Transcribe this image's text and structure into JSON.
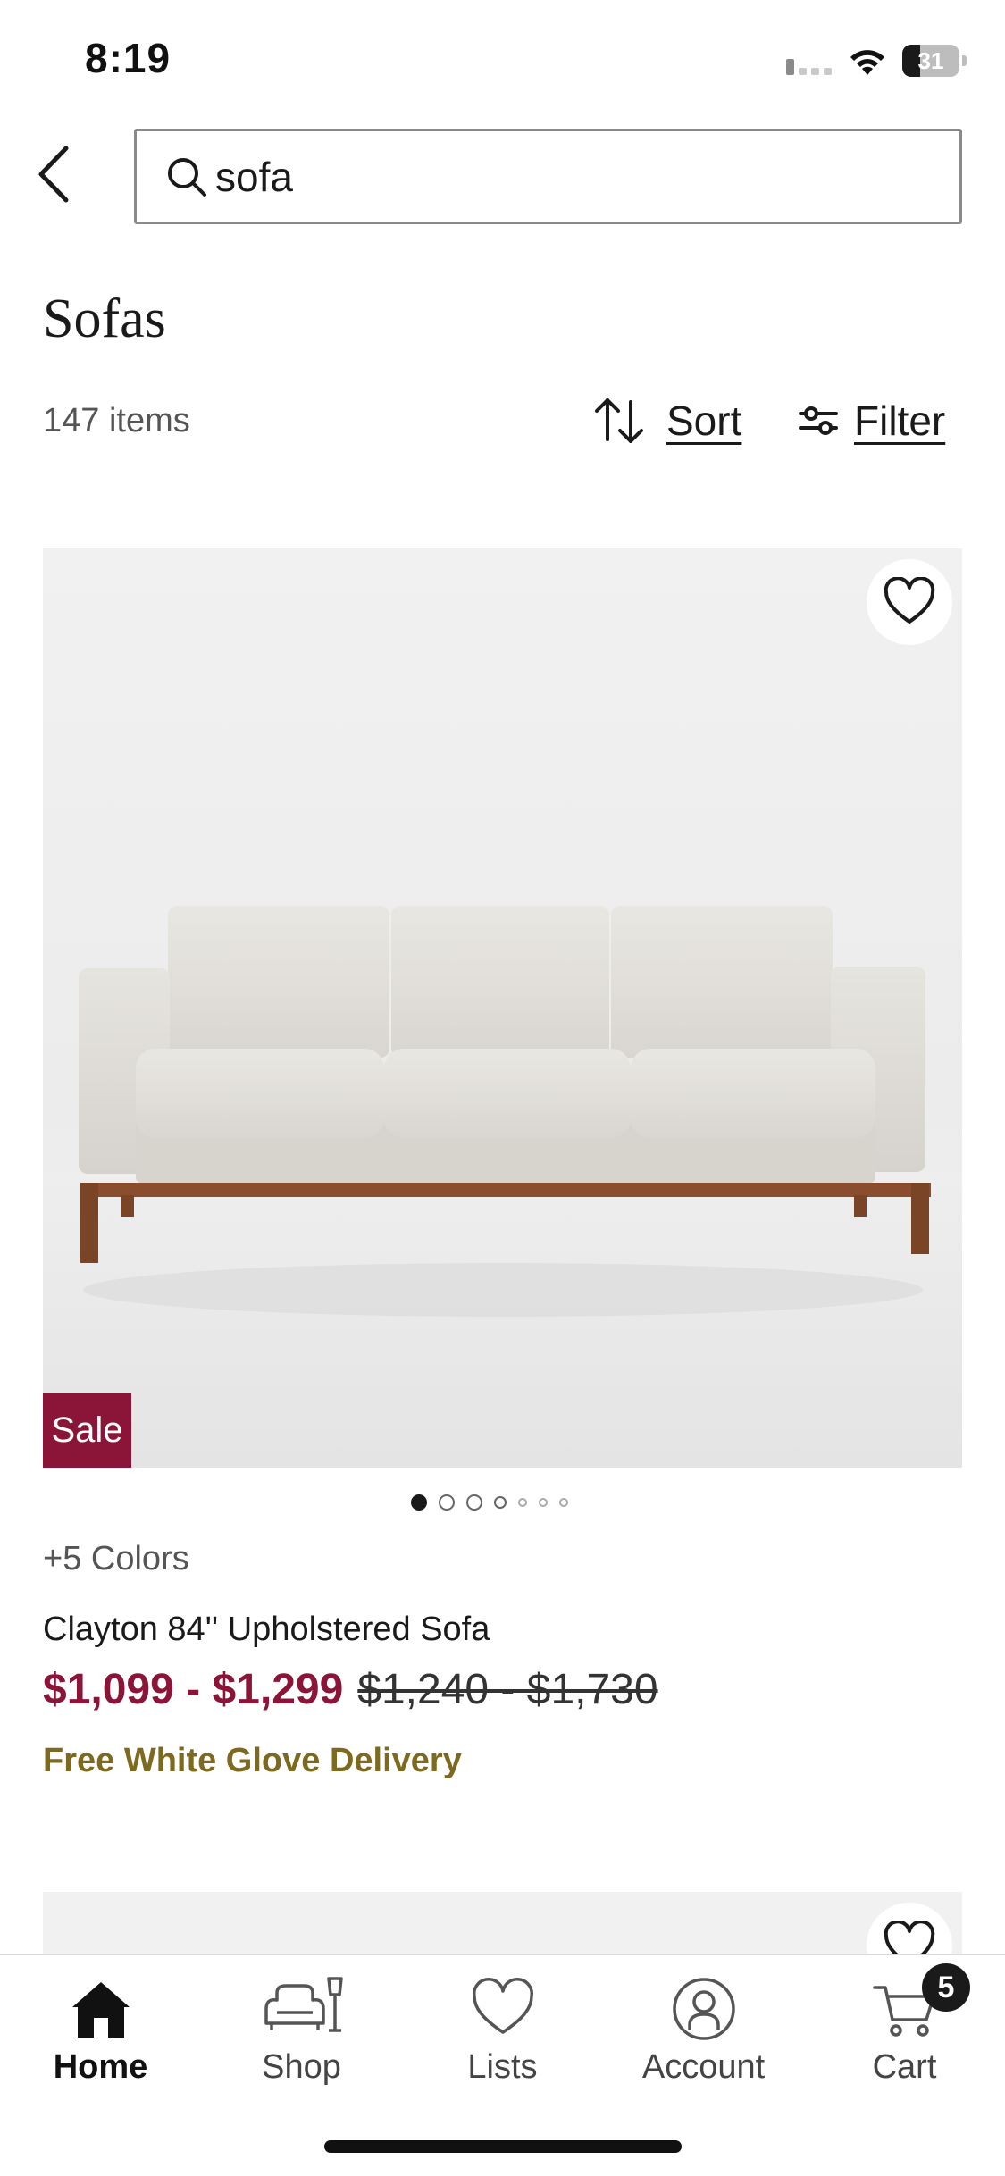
{
  "status_bar": {
    "time": "8:19",
    "battery": "31",
    "battery_level": 0.31
  },
  "search": {
    "value": "sofa",
    "placeholder": "Search"
  },
  "page": {
    "title": "Sofas",
    "item_count": "147 items",
    "sort_label": "Sort",
    "filter_label": "Filter"
  },
  "product": {
    "sale_badge": "Sale",
    "colors": "+5 Colors",
    "name": "Clayton 84'' Upholstered Sofa",
    "price_sale": "$1,099 - $1,299",
    "price_original": "$1,240 - $1,730",
    "delivery": "Free White Glove Delivery",
    "image_count": 7,
    "current_image": 1
  },
  "tabs": [
    {
      "label": "Home",
      "icon": "home-icon",
      "active": true
    },
    {
      "label": "Shop",
      "icon": "shop-icon",
      "active": false
    },
    {
      "label": "Lists",
      "icon": "heart-icon",
      "active": false
    },
    {
      "label": "Account",
      "icon": "account-icon",
      "active": false
    },
    {
      "label": "Cart",
      "icon": "cart-icon",
      "active": false
    }
  ],
  "cart": {
    "count": "5"
  },
  "colors": {
    "sale": "#8b1538",
    "delivery": "#7d6a1e",
    "text": "#1a1a1a",
    "muted": "#555555"
  }
}
